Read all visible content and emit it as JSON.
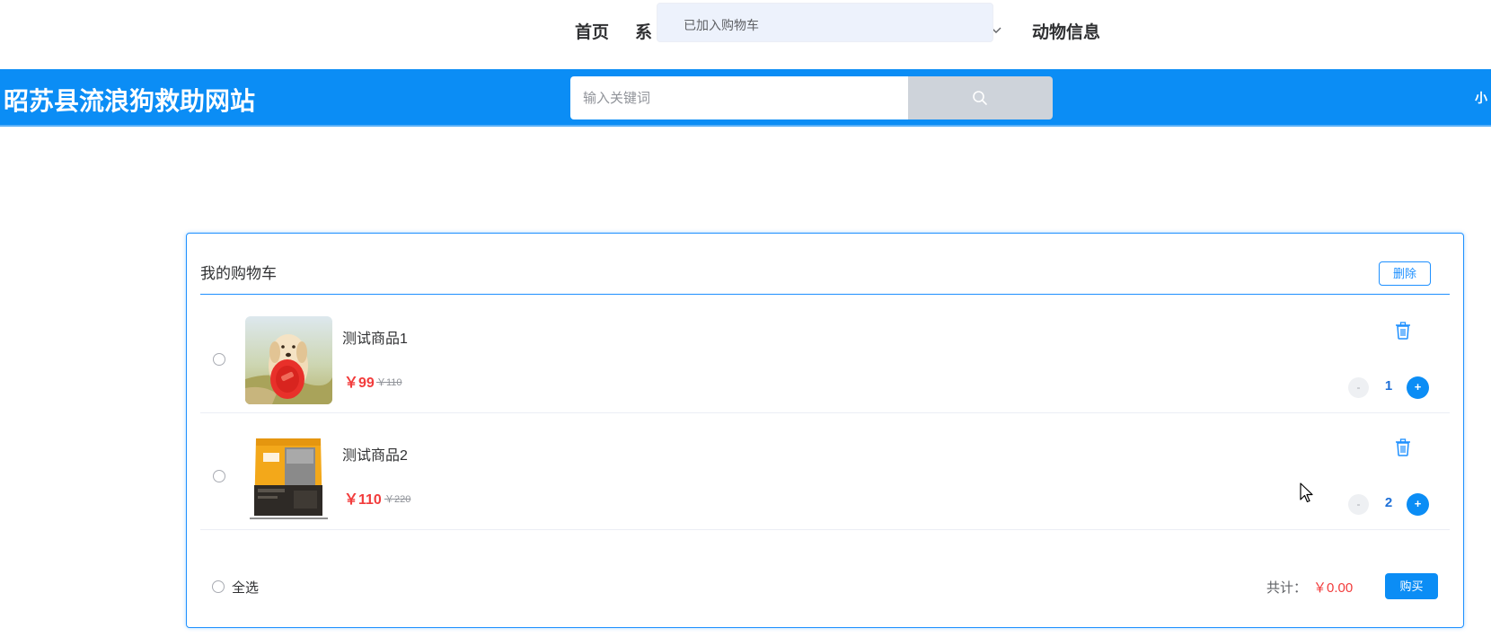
{
  "nav": {
    "home": "首页",
    "system_partial": "系",
    "animal_info": "动物信息"
  },
  "toast": {
    "message": "已加入购物车"
  },
  "header": {
    "site_title": "昭苏县流浪狗救助网站",
    "search_placeholder": "输入关键词",
    "user_partial": "小"
  },
  "cart": {
    "title": "我的购物车",
    "delete_label": "删除",
    "items": [
      {
        "name": "测试商品1",
        "price": "￥99",
        "old_price": "￥110",
        "quantity": "1",
        "image": "golden-retriever-with-frisbee"
      },
      {
        "name": "测试商品2",
        "price": "￥110",
        "old_price": "￥220",
        "quantity": "2",
        "image": "dog-food-bag"
      }
    ],
    "minus_label": "-",
    "plus_label": "+",
    "select_all_label": "全选",
    "total_label": "共计：",
    "total_value": "￥0.00",
    "buy_label": "购买"
  },
  "colors": {
    "primary": "#0b8df5",
    "price": "#f23c3c",
    "toast_bg": "#edf2fc"
  }
}
